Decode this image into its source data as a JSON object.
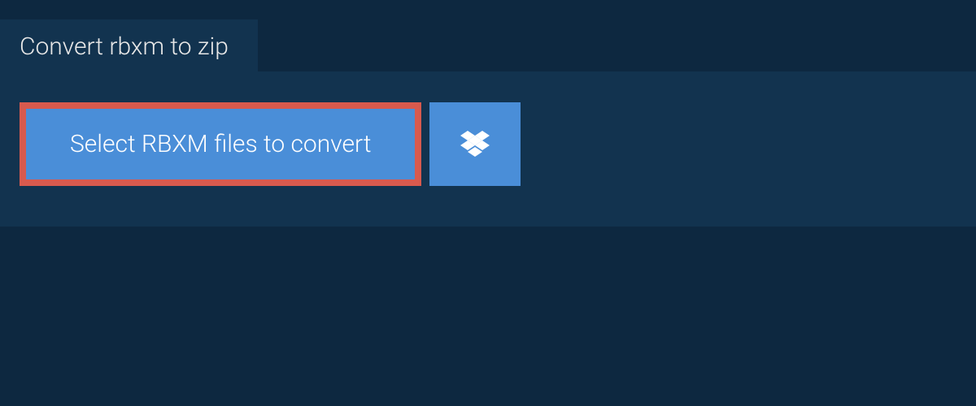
{
  "tab": {
    "title": "Convert rbxm to zip"
  },
  "actions": {
    "select_files_label": "Select RBXM files to convert"
  },
  "colors": {
    "background": "#0d2840",
    "panel": "#12334f",
    "button": "#4a8ed8",
    "highlight_border": "#d85a4e",
    "text": "#e8e8e8",
    "button_text": "#ffffff"
  }
}
